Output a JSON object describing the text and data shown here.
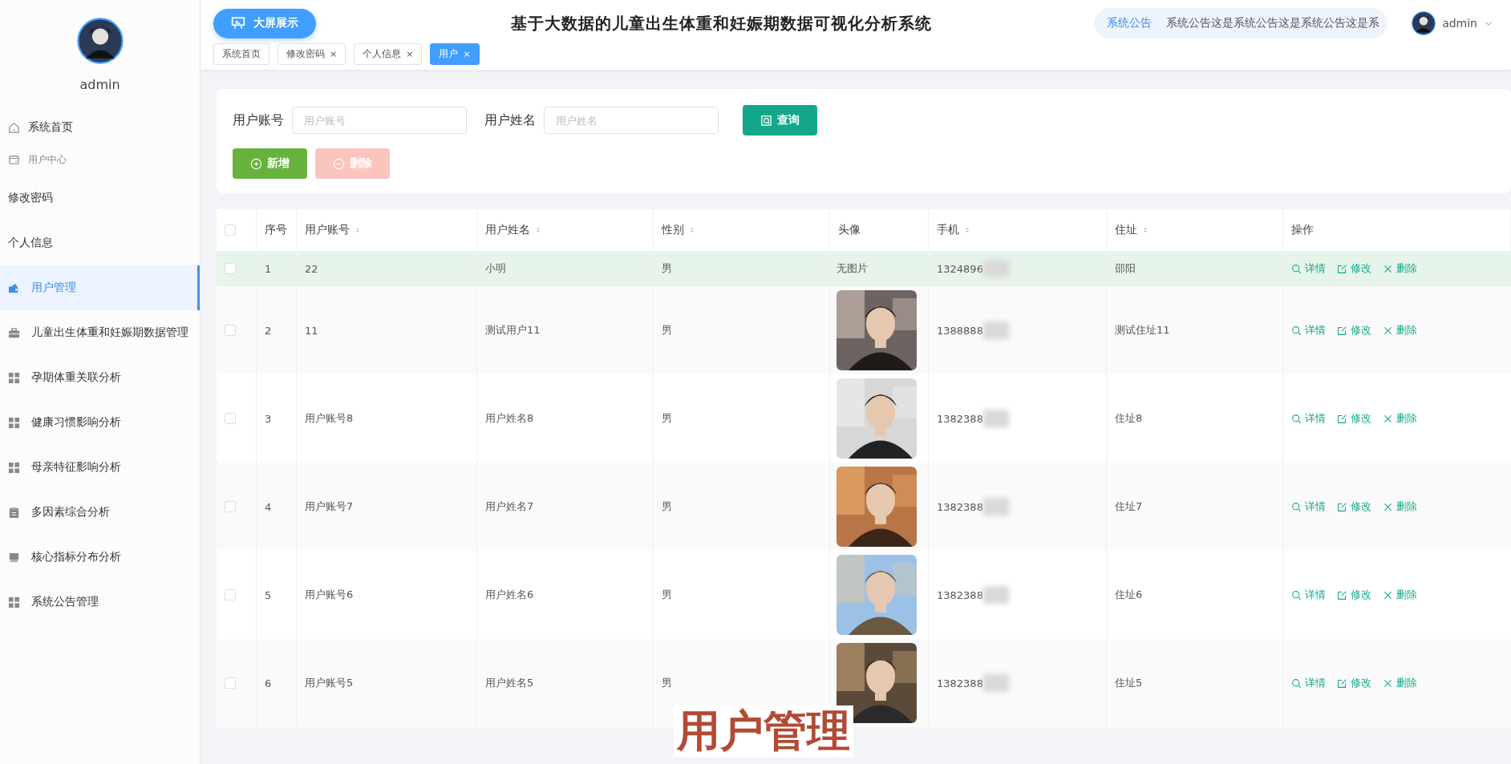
{
  "sidebar": {
    "user": {
      "name": "admin"
    },
    "items": [
      {
        "label": "系统首页",
        "kind": "home",
        "selected": false
      },
      {
        "label": "用户中心",
        "kind": "group",
        "selected": false,
        "children": [
          {
            "label": "修改密码",
            "selected": false
          },
          {
            "label": "个人信息",
            "selected": false
          }
        ]
      },
      {
        "label": "用户管理",
        "kind": "wallet",
        "selected": true
      },
      {
        "label": "儿童出生体重和妊娠期数据管理",
        "kind": "briefcase",
        "selected": false
      },
      {
        "label": "孕期体重关联分析",
        "kind": "grid",
        "selected": false
      },
      {
        "label": "健康习惯影响分析",
        "kind": "grid",
        "selected": false
      },
      {
        "label": "母亲特征影响分析",
        "kind": "grid",
        "selected": false
      },
      {
        "label": "多因素综合分析",
        "kind": "clipboard",
        "selected": false
      },
      {
        "label": "核心指标分布分析",
        "kind": "printer",
        "selected": false
      },
      {
        "label": "系统公告管理",
        "kind": "grid",
        "selected": false
      }
    ]
  },
  "header": {
    "screen_button": "大屏展示",
    "title": "基于大数据的儿童出生体重和妊娠期数据可视化分析系统",
    "notice": {
      "label": "系统公告",
      "text": "系统公告这是系统公告这是系统公告这是系"
    },
    "user": "admin",
    "tabs": [
      {
        "label": "系统首页",
        "selected": false
      },
      {
        "label": "修改密码",
        "close": "×",
        "selected": false
      },
      {
        "label": "个人信息",
        "close": "×",
        "selected": false
      },
      {
        "label": "用户",
        "close": "×",
        "selected": true
      }
    ]
  },
  "search": {
    "fields": [
      {
        "label": "用户账号",
        "placeholder": "用户账号"
      },
      {
        "label": "用户姓名",
        "placeholder": "用户姓名"
      }
    ],
    "query_button": "查询",
    "add_button": "新增",
    "delete_button": {
      "label": "删除",
      "disabled": true
    }
  },
  "table": {
    "select_all": {
      "checked": false
    },
    "columns": [
      {
        "label": "序号",
        "sortable": false
      },
      {
        "label": "用户账号",
        "sortable": true
      },
      {
        "label": "用户姓名",
        "sortable": true
      },
      {
        "label": "性别",
        "sortable": true
      },
      {
        "label": "头像",
        "sortable": false
      },
      {
        "label": "手机",
        "sortable": true
      },
      {
        "label": "住址",
        "sortable": true
      },
      {
        "label": "操作",
        "sortable": false
      }
    ],
    "rows": [
      {
        "checked": false,
        "highlighted": true,
        "no": "1",
        "account": "22",
        "name": "小明",
        "gender": "男",
        "avatar": {
          "kind": "text",
          "text": "无图片"
        },
        "phone": "1324896",
        "address": "邵阳",
        "actions": [
          "详情",
          "修改",
          "删除"
        ]
      },
      {
        "checked": false,
        "highlighted": false,
        "no": "2",
        "account": "11",
        "name": "测试用户11",
        "gender": "男",
        "avatar": {
          "kind": "picture"
        },
        "phone": "1388888",
        "address": "测试住址11",
        "actions": [
          "详情",
          "修改",
          "删除"
        ]
      },
      {
        "checked": false,
        "highlighted": false,
        "no": "3",
        "account": "用户账号8",
        "name": "用户姓名8",
        "gender": "男",
        "avatar": {
          "kind": "picture"
        },
        "phone": "1382388",
        "address": "住址8",
        "actions": [
          "详情",
          "修改",
          "删除"
        ]
      },
      {
        "checked": false,
        "highlighted": false,
        "no": "4",
        "account": "用户账号7",
        "name": "用户姓名7",
        "gender": "男",
        "avatar": {
          "kind": "picture"
        },
        "phone": "1382388",
        "address": "住址7",
        "actions": [
          "详情",
          "修改",
          "删除"
        ]
      },
      {
        "checked": false,
        "highlighted": false,
        "no": "5",
        "account": "用户账号6",
        "name": "用户姓名6",
        "gender": "男",
        "avatar": {
          "kind": "picture"
        },
        "phone": "1382388",
        "address": "住址6",
        "actions": [
          "详情",
          "修改",
          "删除"
        ]
      },
      {
        "checked": false,
        "highlighted": false,
        "no": "6",
        "account": "用户账号5",
        "name": "用户姓名5",
        "gender": "男",
        "avatar": {
          "kind": "picture"
        },
        "phone": "1382388",
        "address": "住址5",
        "actions": [
          "详情",
          "修改",
          "删除"
        ]
      }
    ]
  },
  "caption": "用户管理"
}
